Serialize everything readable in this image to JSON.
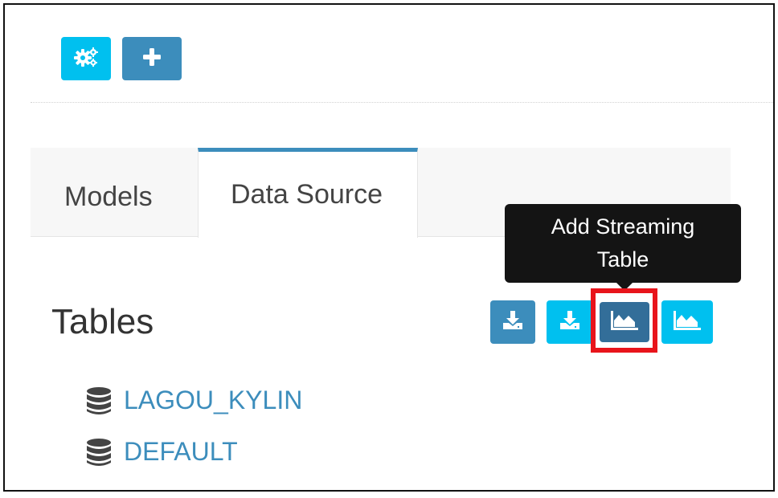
{
  "toolbar": {
    "settings_icon": "cogs-icon",
    "add_icon": "plus-icon"
  },
  "tabs": [
    {
      "label": "Models",
      "active": false
    },
    {
      "label": "Data Source",
      "active": true
    }
  ],
  "tables": {
    "title": "Tables",
    "actions": [
      {
        "icon": "download-icon",
        "color": "#3c8dbc"
      },
      {
        "icon": "download-icon",
        "color": "#00c0ef"
      },
      {
        "icon": "area-chart-icon",
        "color": "#336e99"
      },
      {
        "icon": "area-chart-icon",
        "color": "#00c0ef"
      }
    ],
    "tooltip": [
      "Add Streaming",
      "Table"
    ],
    "databases": [
      {
        "name": "LAGOU_KYLIN",
        "icon": "database-icon"
      },
      {
        "name": "DEFAULT",
        "icon": "database-icon"
      }
    ]
  },
  "colors": {
    "cyan": "#00c0ef",
    "blue": "#3c8dbc",
    "highlight": "#e8141b",
    "tooltip_bg": "#141414"
  }
}
